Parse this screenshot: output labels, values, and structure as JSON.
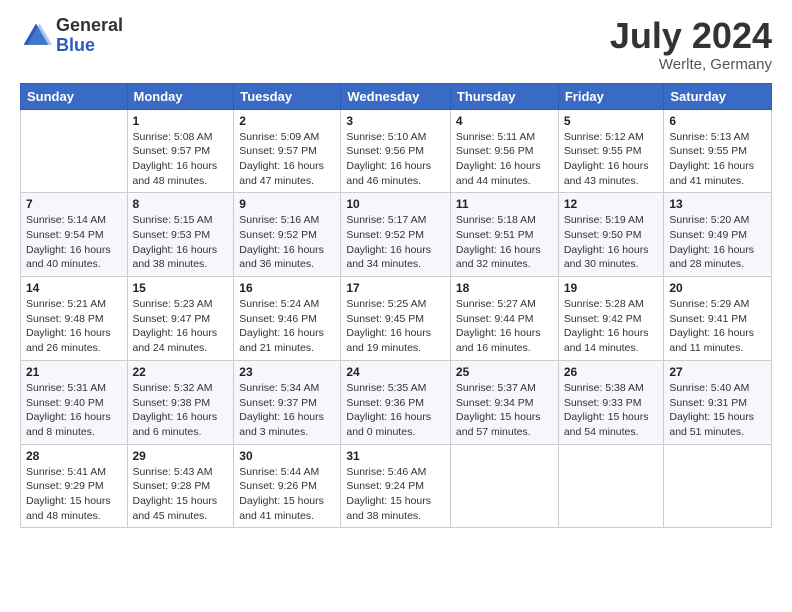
{
  "header": {
    "logo": {
      "general": "General",
      "blue": "Blue"
    },
    "title": "July 2024",
    "location": "Werlte, Germany"
  },
  "calendar": {
    "days_of_week": [
      "Sunday",
      "Monday",
      "Tuesday",
      "Wednesday",
      "Thursday",
      "Friday",
      "Saturday"
    ],
    "weeks": [
      [
        {
          "day": "",
          "info": ""
        },
        {
          "day": "1",
          "info": "Sunrise: 5:08 AM\nSunset: 9:57 PM\nDaylight: 16 hours and 48 minutes."
        },
        {
          "day": "2",
          "info": "Sunrise: 5:09 AM\nSunset: 9:57 PM\nDaylight: 16 hours and 47 minutes."
        },
        {
          "day": "3",
          "info": "Sunrise: 5:10 AM\nSunset: 9:56 PM\nDaylight: 16 hours and 46 minutes."
        },
        {
          "day": "4",
          "info": "Sunrise: 5:11 AM\nSunset: 9:56 PM\nDaylight: 16 hours and 44 minutes."
        },
        {
          "day": "5",
          "info": "Sunrise: 5:12 AM\nSunset: 9:55 PM\nDaylight: 16 hours and 43 minutes."
        },
        {
          "day": "6",
          "info": "Sunrise: 5:13 AM\nSunset: 9:55 PM\nDaylight: 16 hours and 41 minutes."
        }
      ],
      [
        {
          "day": "7",
          "info": "Sunrise: 5:14 AM\nSunset: 9:54 PM\nDaylight: 16 hours and 40 minutes."
        },
        {
          "day": "8",
          "info": "Sunrise: 5:15 AM\nSunset: 9:53 PM\nDaylight: 16 hours and 38 minutes."
        },
        {
          "day": "9",
          "info": "Sunrise: 5:16 AM\nSunset: 9:52 PM\nDaylight: 16 hours and 36 minutes."
        },
        {
          "day": "10",
          "info": "Sunrise: 5:17 AM\nSunset: 9:52 PM\nDaylight: 16 hours and 34 minutes."
        },
        {
          "day": "11",
          "info": "Sunrise: 5:18 AM\nSunset: 9:51 PM\nDaylight: 16 hours and 32 minutes."
        },
        {
          "day": "12",
          "info": "Sunrise: 5:19 AM\nSunset: 9:50 PM\nDaylight: 16 hours and 30 minutes."
        },
        {
          "day": "13",
          "info": "Sunrise: 5:20 AM\nSunset: 9:49 PM\nDaylight: 16 hours and 28 minutes."
        }
      ],
      [
        {
          "day": "14",
          "info": "Sunrise: 5:21 AM\nSunset: 9:48 PM\nDaylight: 16 hours and 26 minutes."
        },
        {
          "day": "15",
          "info": "Sunrise: 5:23 AM\nSunset: 9:47 PM\nDaylight: 16 hours and 24 minutes."
        },
        {
          "day": "16",
          "info": "Sunrise: 5:24 AM\nSunset: 9:46 PM\nDaylight: 16 hours and 21 minutes."
        },
        {
          "day": "17",
          "info": "Sunrise: 5:25 AM\nSunset: 9:45 PM\nDaylight: 16 hours and 19 minutes."
        },
        {
          "day": "18",
          "info": "Sunrise: 5:27 AM\nSunset: 9:44 PM\nDaylight: 16 hours and 16 minutes."
        },
        {
          "day": "19",
          "info": "Sunrise: 5:28 AM\nSunset: 9:42 PM\nDaylight: 16 hours and 14 minutes."
        },
        {
          "day": "20",
          "info": "Sunrise: 5:29 AM\nSunset: 9:41 PM\nDaylight: 16 hours and 11 minutes."
        }
      ],
      [
        {
          "day": "21",
          "info": "Sunrise: 5:31 AM\nSunset: 9:40 PM\nDaylight: 16 hours and 8 minutes."
        },
        {
          "day": "22",
          "info": "Sunrise: 5:32 AM\nSunset: 9:38 PM\nDaylight: 16 hours and 6 minutes."
        },
        {
          "day": "23",
          "info": "Sunrise: 5:34 AM\nSunset: 9:37 PM\nDaylight: 16 hours and 3 minutes."
        },
        {
          "day": "24",
          "info": "Sunrise: 5:35 AM\nSunset: 9:36 PM\nDaylight: 16 hours and 0 minutes."
        },
        {
          "day": "25",
          "info": "Sunrise: 5:37 AM\nSunset: 9:34 PM\nDaylight: 15 hours and 57 minutes."
        },
        {
          "day": "26",
          "info": "Sunrise: 5:38 AM\nSunset: 9:33 PM\nDaylight: 15 hours and 54 minutes."
        },
        {
          "day": "27",
          "info": "Sunrise: 5:40 AM\nSunset: 9:31 PM\nDaylight: 15 hours and 51 minutes."
        }
      ],
      [
        {
          "day": "28",
          "info": "Sunrise: 5:41 AM\nSunset: 9:29 PM\nDaylight: 15 hours and 48 minutes."
        },
        {
          "day": "29",
          "info": "Sunrise: 5:43 AM\nSunset: 9:28 PM\nDaylight: 15 hours and 45 minutes."
        },
        {
          "day": "30",
          "info": "Sunrise: 5:44 AM\nSunset: 9:26 PM\nDaylight: 15 hours and 41 minutes."
        },
        {
          "day": "31",
          "info": "Sunrise: 5:46 AM\nSunset: 9:24 PM\nDaylight: 15 hours and 38 minutes."
        },
        {
          "day": "",
          "info": ""
        },
        {
          "day": "",
          "info": ""
        },
        {
          "day": "",
          "info": ""
        }
      ]
    ]
  }
}
